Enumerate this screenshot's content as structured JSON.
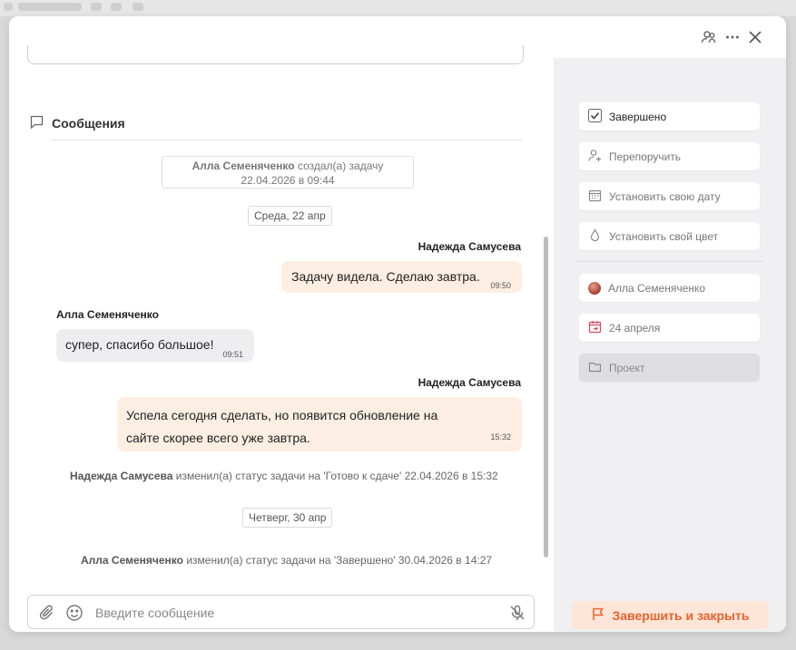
{
  "colors": {
    "accent": "#e8622c",
    "bubble_out": "#fdeee3",
    "bubble_in": "#eeeef0",
    "sidebar_bg": "#f0f0f2"
  },
  "header": {
    "icons": [
      "members-icon",
      "more-icon",
      "close-icon"
    ]
  },
  "messages_section": {
    "title": "Сообщения"
  },
  "system_created": {
    "author": "Алла Семеняченко",
    "text": "создал(а) задачу",
    "datetime": "22.04.2026 в 09:44"
  },
  "date_separators": [
    "Среда, 22 апр",
    "Четверг, 30 апр"
  ],
  "messages": [
    {
      "author": "Надежда Самусева",
      "text": "Задачу видела. Сделаю завтра.",
      "time": "09:50",
      "direction": "out"
    },
    {
      "author": "Алла Семеняченко",
      "text": "супер, спасибо большое!",
      "time": "09:51",
      "direction": "in"
    },
    {
      "author": "Надежда Самусева",
      "line1": "Успела сегодня сделать, но появится обновление на",
      "line2": "сайте скорее всего уже завтра.",
      "time": "15:32",
      "direction": "out"
    }
  ],
  "status_changes": [
    {
      "author": "Надежда Самусева",
      "text": "изменил(а) статус задачи на 'Готово к сдаче' 22.04.2026 в 15:32"
    },
    {
      "author": "Алла Семеняченко",
      "text": "изменил(а) статус задачи на 'Завершено' 30.04.2026 в 14:27"
    }
  ],
  "composer": {
    "placeholder": "Введите сообщение",
    "value": ""
  },
  "sidebar": {
    "complete": "Завершено",
    "reassign": "Перепоручить",
    "set_date": "Установить свою дату",
    "set_color": "Установить свой цвет",
    "assignee": "Алла Семеняченко",
    "deadline": "24 апреля",
    "project": "Проект"
  },
  "finish_button": "Завершить и закрыть"
}
